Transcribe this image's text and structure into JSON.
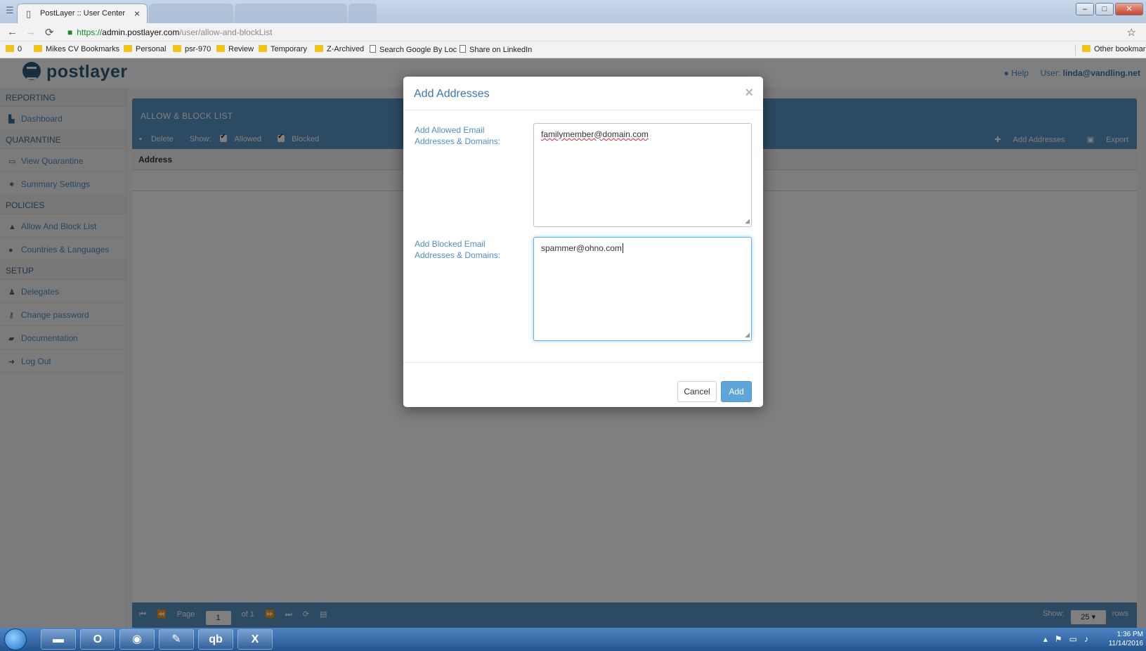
{
  "browser": {
    "tab_title": "PostLayer :: User Center",
    "tab_close": "×",
    "url_scheme": "https://",
    "url_host": "admin.postlayer.com",
    "url_path": "/user/allow-and-blockList",
    "bookmarks": [
      "0",
      "Mikes CV Bookmarks",
      "Personal",
      "psr-970",
      "Review",
      "Temporary",
      "Z-Archived"
    ],
    "bookmark_pages": [
      "Search Google By Loc",
      "Share on LinkedIn"
    ],
    "other_bookmarks": "Other bookmarks"
  },
  "header": {
    "logo": "postlayer",
    "help": "Help",
    "user_label": "User: ",
    "user_value": "linda@vandling.net"
  },
  "sidebar": {
    "sections": [
      {
        "title": "REPORTING",
        "items": [
          {
            "label": "Dashboard",
            "icon": "chart-icon"
          }
        ]
      },
      {
        "title": "QUARANTINE",
        "items": [
          {
            "label": "View Quarantine",
            "icon": "inbox-icon"
          },
          {
            "label": "Summary Settings",
            "icon": "gear-icon"
          }
        ]
      },
      {
        "title": "POLICIES",
        "items": [
          {
            "label": "Allow And Block List",
            "icon": "thumbs-up-icon"
          },
          {
            "label": "Countries & Languages",
            "icon": "globe-icon"
          }
        ]
      },
      {
        "title": "SETUP",
        "items": [
          {
            "label": "Delegates",
            "icon": "group-icon"
          },
          {
            "label": "Change password",
            "icon": "key-icon"
          },
          {
            "label": "Documentation",
            "icon": "book-icon"
          },
          {
            "label": "Log Out",
            "icon": "logout-icon"
          }
        ]
      }
    ]
  },
  "main": {
    "panel_title": "ALLOW & BLOCK LIST",
    "toolbar": {
      "delete": "Delete",
      "show": "Show:",
      "allowed": "Allowed",
      "blocked": "Blocked",
      "add_addresses": "Add Addresses",
      "export": "Export"
    },
    "column_address": "Address",
    "pager": {
      "page_label": "Page",
      "page_value": "1",
      "of_label": "of 1",
      "show_label": "Show:",
      "rows_value": "25",
      "rows_label": "rows"
    }
  },
  "modal": {
    "title": "Add Addresses",
    "close": "×",
    "allowed_label": "Add Allowed Email Addresses & Domains:",
    "allowed_value": "familymember@domain.com",
    "blocked_label": "Add Blocked Email Addresses & Domains:",
    "blocked_value": "spammer@ohno.com",
    "cancel": "Cancel",
    "add": "Add"
  },
  "taskbar": {
    "time": "1:36 PM",
    "date": "11/14/2016"
  },
  "colors": {
    "brand": "#2d5d7b",
    "accent": "#5a95c7",
    "link": "#4e8fc4",
    "primary_button": "#5ea5da"
  }
}
